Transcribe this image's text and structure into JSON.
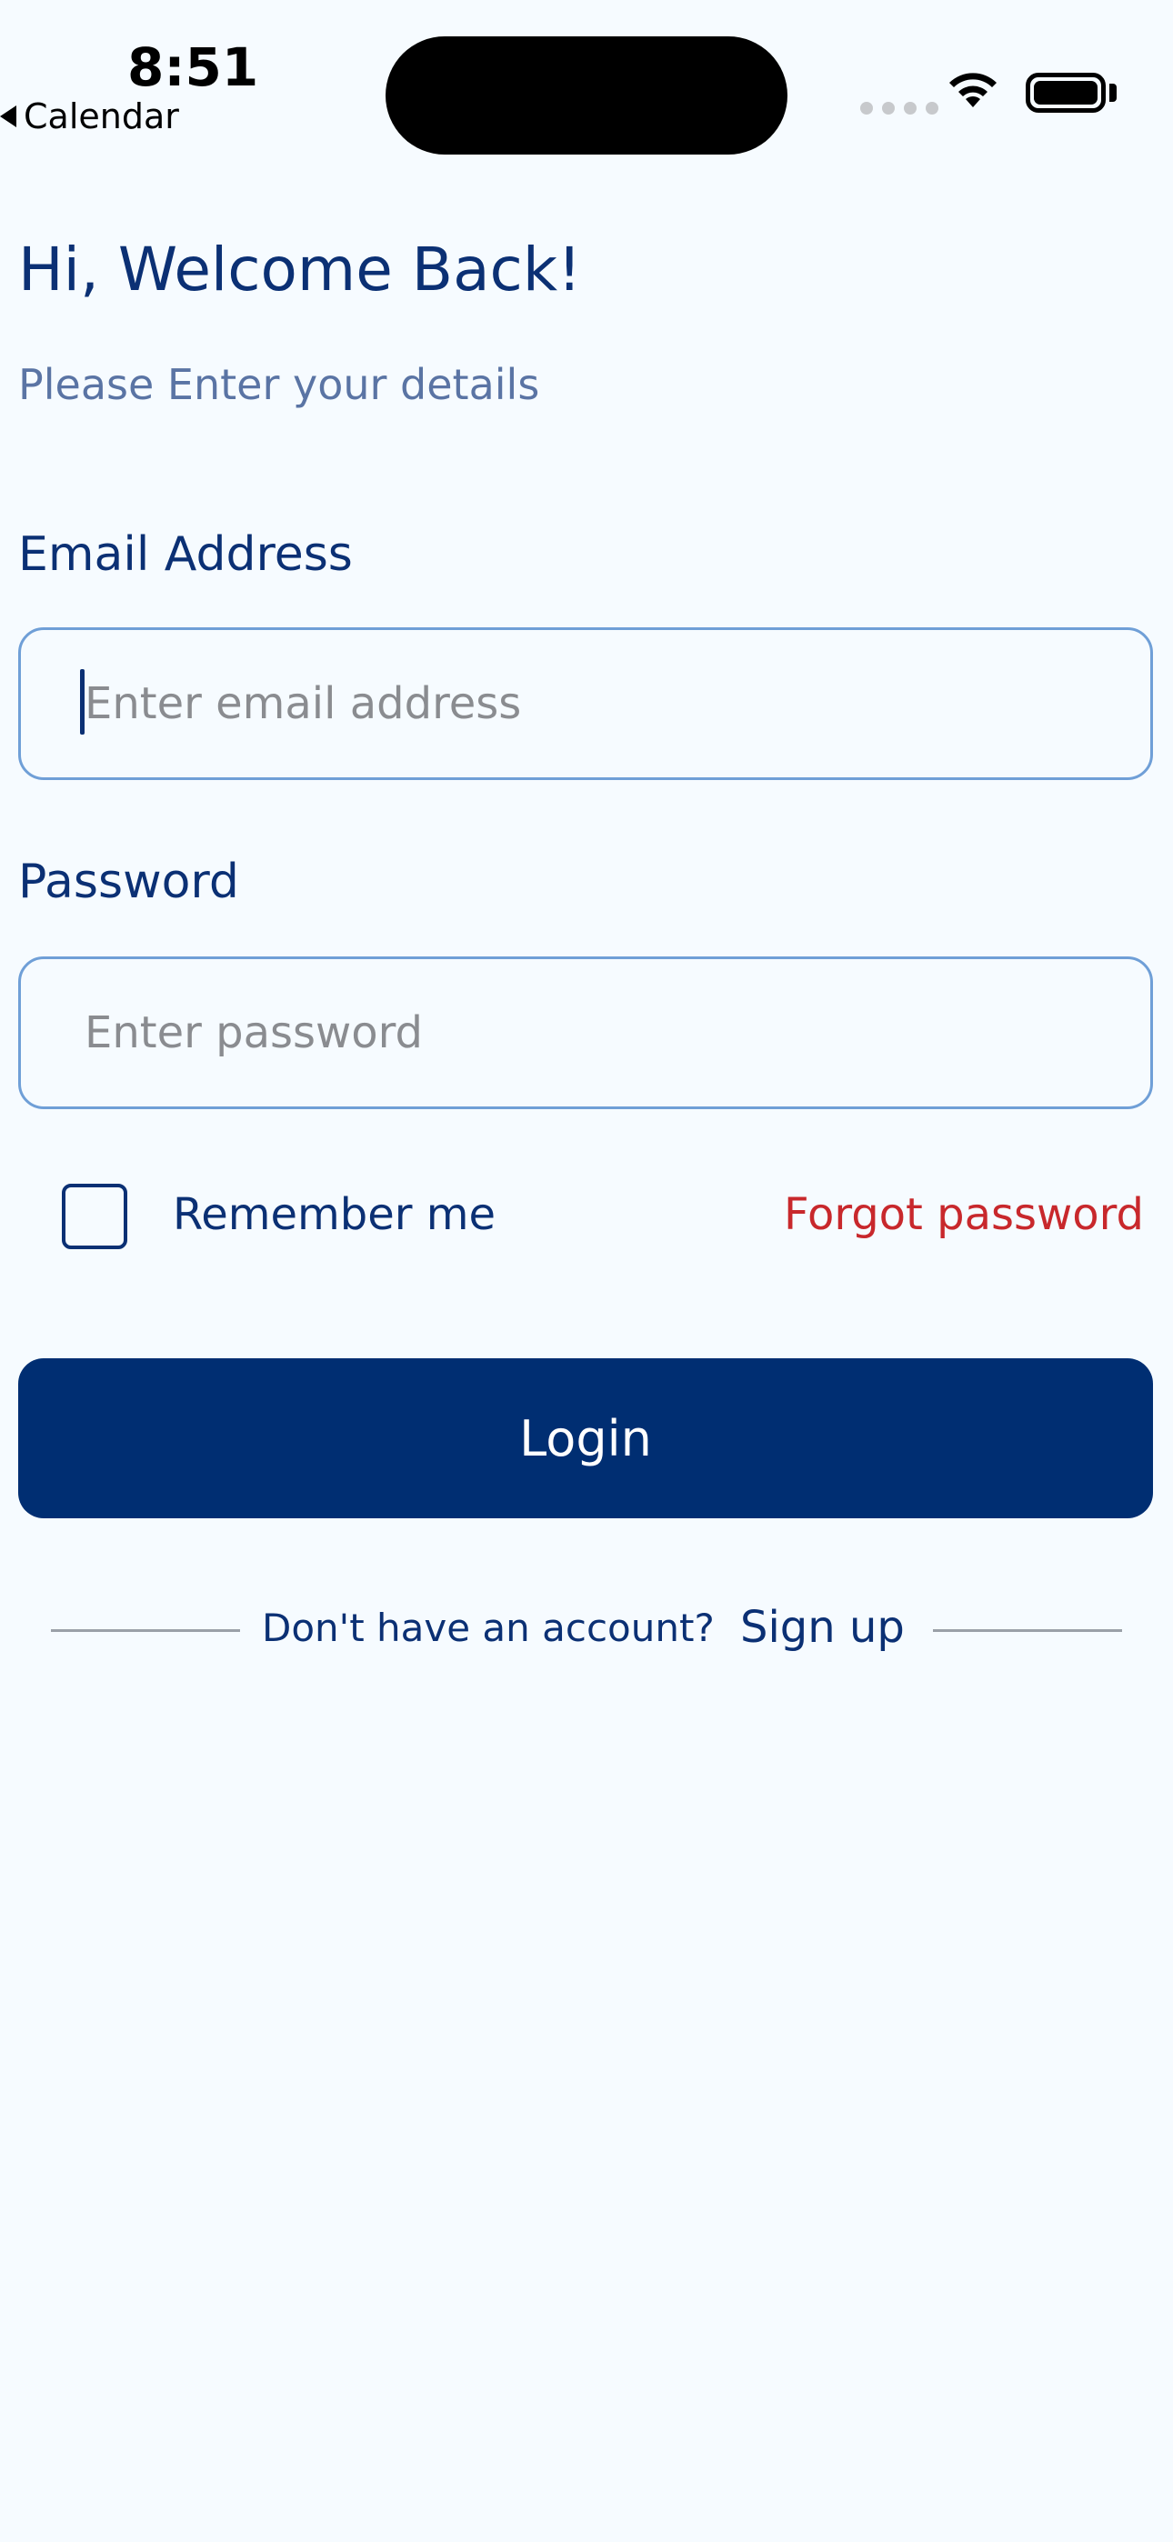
{
  "status_bar": {
    "time": "8:51",
    "back_app": "Calendar"
  },
  "header": {
    "title": "Hi, Welcome Back!",
    "subtitle": "Please Enter your details"
  },
  "form": {
    "email": {
      "label": "Email Address",
      "placeholder": "Enter email address",
      "value": ""
    },
    "password": {
      "label": "Password",
      "placeholder": "Enter password",
      "value": ""
    },
    "remember_label": "Remember me",
    "remember_checked": false,
    "forgot_label": "Forgot password",
    "login_label": "Login"
  },
  "footer": {
    "prompt": "Don't have an account?",
    "signup_label": "Sign up"
  },
  "colors": {
    "background": "#f6fbff",
    "primary": "#002e72",
    "heading": "#0b3074",
    "subtitle": "#5a74a4",
    "input_border": "#6f9fd7",
    "forgot": "#c8282c"
  },
  "icons": {
    "back": "back-triangle-icon",
    "signal": "cellular-signal-icon",
    "wifi": "wifi-icon",
    "battery": "battery-icon"
  }
}
